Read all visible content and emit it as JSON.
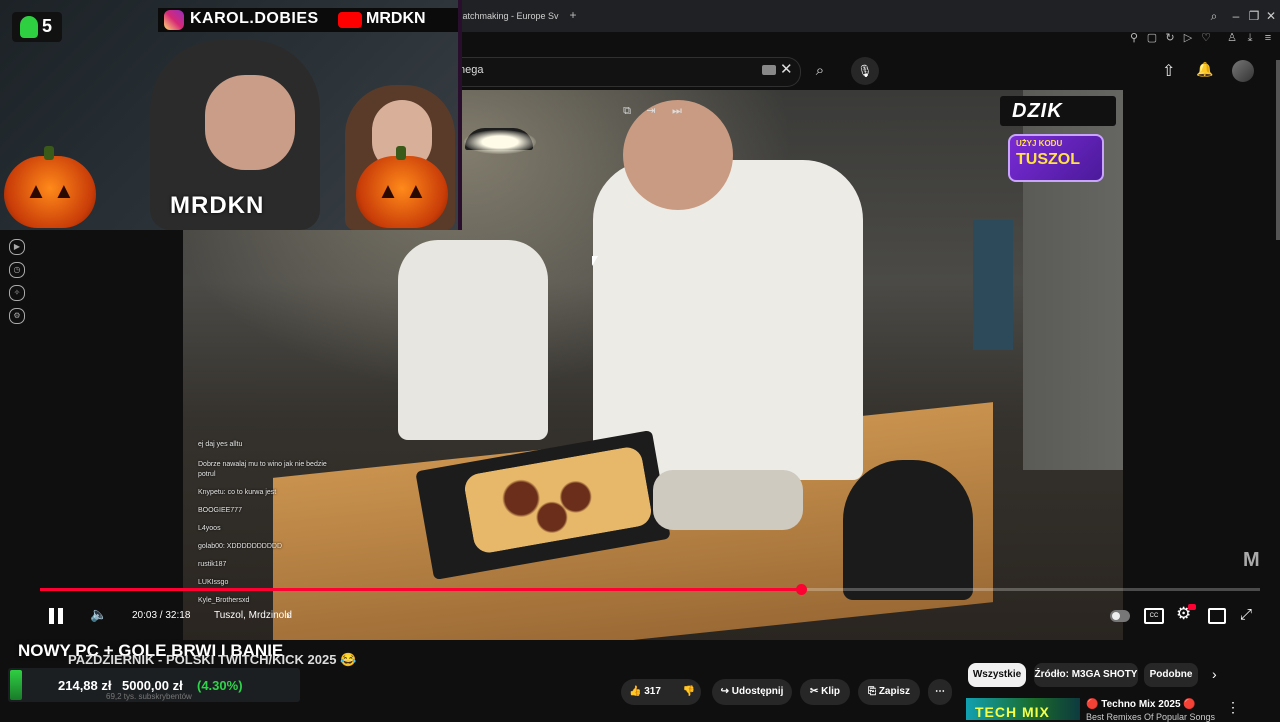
{
  "browser": {
    "tab_title": "Matchmaking - Europe Sv",
    "new_tab_icon": "+",
    "window_icons": [
      "search-icon",
      "minimize-icon",
      "restore-icon",
      "close-icon"
    ],
    "toolbar_icons": [
      "pin-icon",
      "square-icon",
      "refresh-icon",
      "play-icon",
      "heart-icon",
      "person-icon",
      "download-icon",
      "menu-icon"
    ]
  },
  "youtube": {
    "search": {
      "value": "nega"
    },
    "header_icons": [
      "upload-icon",
      "bell-icon",
      "avatar-icon"
    ]
  },
  "sidebar_icons": [
    "play-circle-icon",
    "history-icon",
    "puzzle-icon",
    "settings-icon"
  ],
  "webcam": {
    "sub_count": "5",
    "instagram_handle": "KAROL.DOBIES",
    "youtube_handle": "MRDKN",
    "streamer_name": "MRDKN"
  },
  "sponsor": {
    "logo": "DZIK",
    "code_label": "UŻYJ KODU",
    "code": "TUSZOL"
  },
  "chat": [
    {
      "text": "ej daj yes alltu",
      "tone": "#e6e6e6"
    },
    {
      "text": "Dobrze nawalaj mu to wino jak nie bedzie",
      "tone": "#e6e6e6"
    },
    {
      "text": "potrul",
      "tone": "#e6e6e6"
    },
    {
      "text": "Knypetu: co to kurwa jest",
      "tone": "#e6e6e6"
    },
    {
      "text": "BOOGIEE777",
      "tone": "#e6e6e6"
    },
    {
      "text": "L4yoos",
      "tone": "#e6e6e6"
    },
    {
      "text": "golab00: XDDDDDDDDDD",
      "tone": "#e6e6e6"
    },
    {
      "text": "rustik187",
      "tone": "#e6e6e6"
    },
    {
      "text": "LUKIssgo",
      "tone": "#e6e6e6"
    },
    {
      "text": "Kyle_Brothersxd",
      "tone": "#e6e6e6"
    }
  ],
  "player": {
    "progress": 0.6235,
    "current_time": "20:03",
    "duration": "32:18",
    "time_display": "20:03 / 32:18",
    "chapter": "Tuszol, Mrdzinold",
    "watermark": "M",
    "top_icons": [
      "miniplayer-icon",
      "exit-icon",
      "skip-icon"
    ]
  },
  "video_info": {
    "overlay_title": "NOWY PC + GOLE BRWI I BANIE",
    "title": "PAŹDZIERNIK - POLSKI TWITCH/KICK 2025 😂",
    "crypto_price": "214,88 zł",
    "crypto_target": "5000,00 zł",
    "crypto_change": "(4.30%)",
    "channel_faint": "69,2 tys. subskrybentów"
  },
  "actions": {
    "like_count": "317",
    "share_label": "Udostępnij",
    "clip_label": "Klip",
    "save_label": "Zapisz",
    "more_icon": "⋯"
  },
  "chips": {
    "all": "Wszystkie",
    "source": "Źródło: M3GA SHOTY",
    "similar": "Podobne"
  },
  "recommendation": {
    "thumb_text": "TECH MIX",
    "title": "🔴 Techno Mix 2025 🔴",
    "subtitle": "Best Remixes Of Popular Songs"
  },
  "colors": {
    "accent": "#ff0033",
    "background": "#0f0f0f",
    "positive": "#2fd34a",
    "sponsor_purple": "#7a2bd6",
    "sponsor_yellow": "#ffe14a"
  }
}
